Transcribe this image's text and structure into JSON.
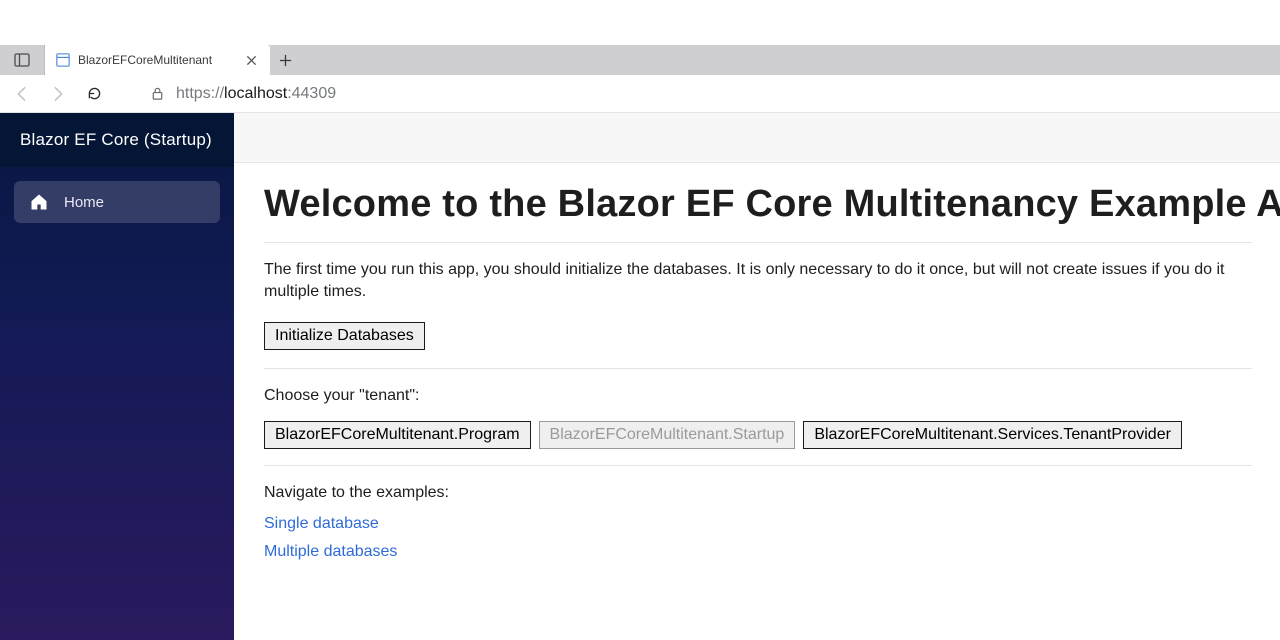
{
  "browser": {
    "tab_title": "BlazorEFCoreMultitenant",
    "url_protocol": "https://",
    "url_host": "localhost",
    "url_port": ":44309"
  },
  "sidebar": {
    "brand": "Blazor EF Core (Startup)",
    "items": [
      {
        "label": "Home"
      }
    ]
  },
  "content": {
    "heading": "Welcome to the Blazor EF Core Multitenancy Example App",
    "intro_text": "The first time you run this app, you should initialize the databases. It is only necessary to do it once, but will not create issues if you do it multiple times.",
    "init_button": "Initialize Databases",
    "choose_tenant_label": "Choose your \"tenant\":",
    "tenant_buttons": [
      {
        "label": "BlazorEFCoreMultitenant.Program",
        "disabled": false
      },
      {
        "label": "BlazorEFCoreMultitenant.Startup",
        "disabled": true
      },
      {
        "label": "BlazorEFCoreMultitenant.Services.TenantProvider",
        "disabled": false
      }
    ],
    "navigate_label": "Navigate to the examples:",
    "links": [
      {
        "label": "Single database"
      },
      {
        "label": "Multiple databases"
      }
    ]
  }
}
